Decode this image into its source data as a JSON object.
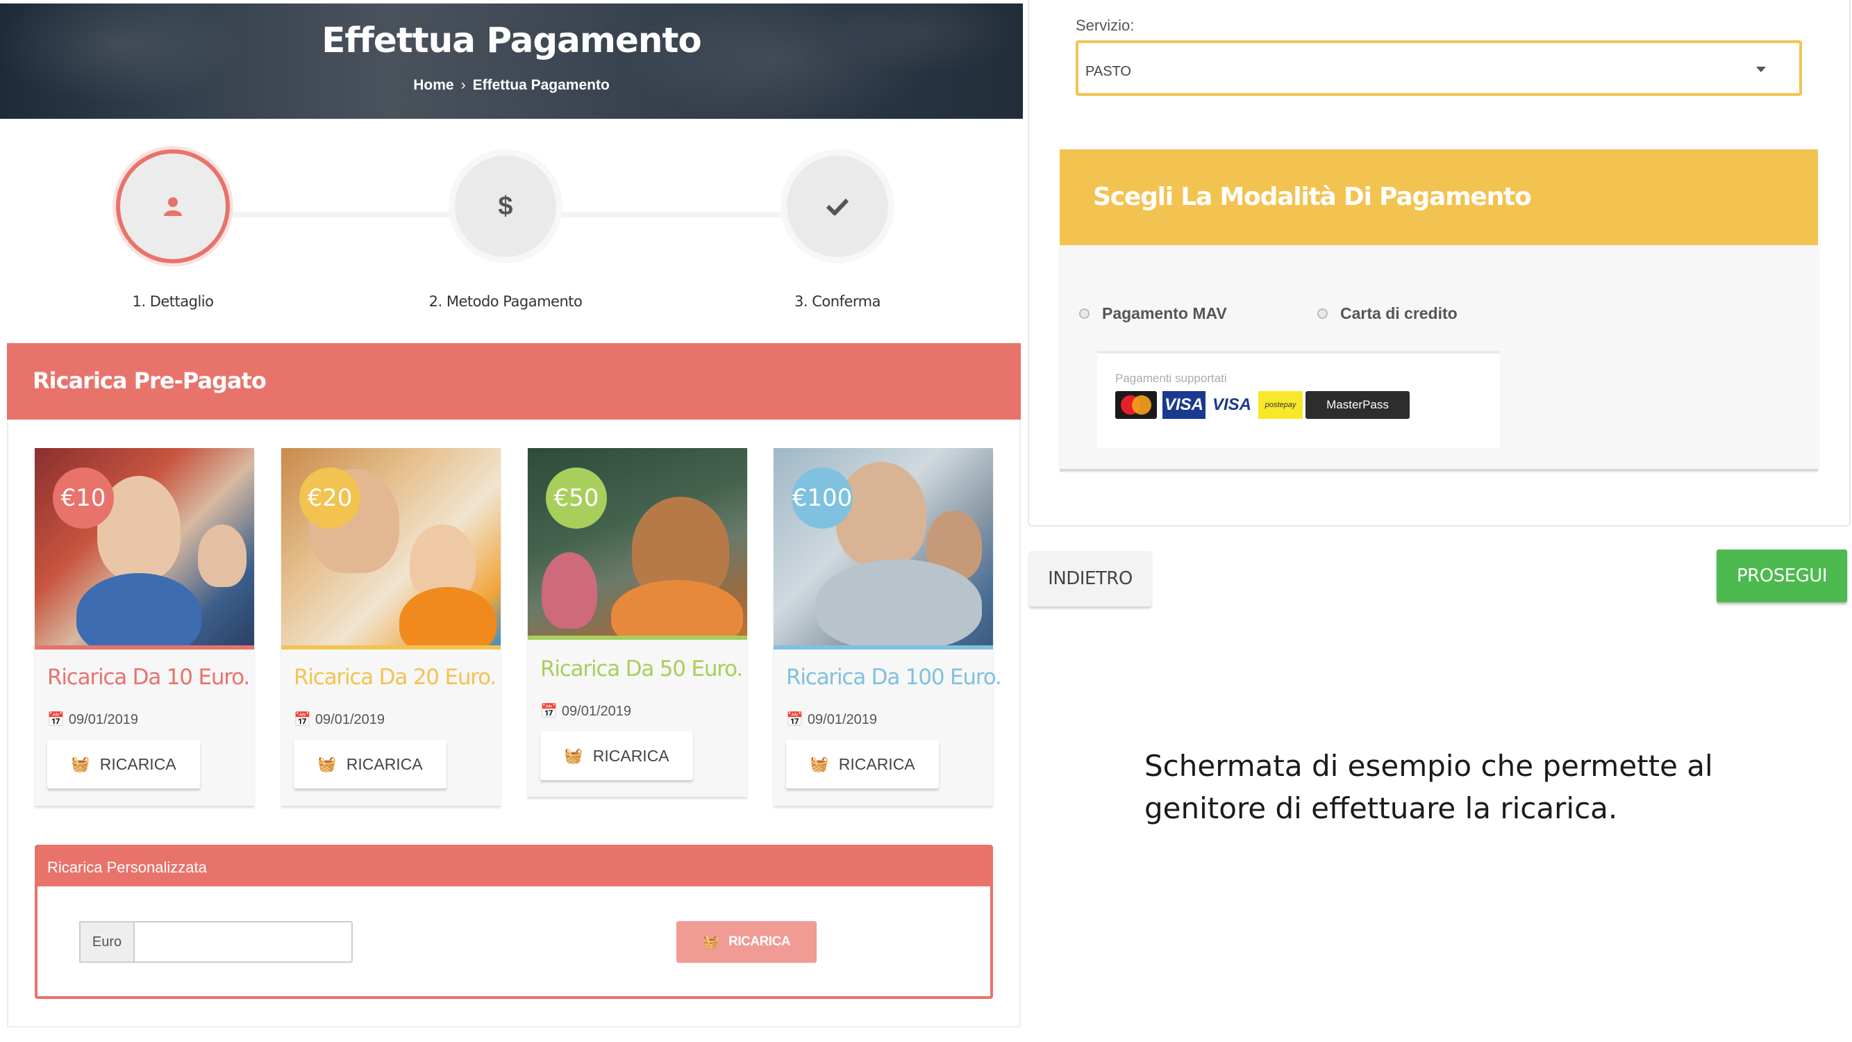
{
  "hero": {
    "title": "Effettua Pagamento",
    "breadcrumb_home": "Home",
    "breadcrumb_current": "Effettua Pagamento"
  },
  "steps": [
    {
      "label": "1. Dettaglio",
      "icon": "user-icon",
      "active": true
    },
    {
      "label": "2. Metodo Pagamento",
      "icon": "dollar-icon",
      "active": false
    },
    {
      "label": "3. Conferma",
      "icon": "check-icon",
      "active": false
    }
  ],
  "prepaid": {
    "title": "Ricarica Pre-Pagato",
    "cards": [
      {
        "price": "€10",
        "title": "Ricarica Da 10 Euro.",
        "date": "09/01/2019",
        "button": "RICARICA",
        "color": "#e8736b"
      },
      {
        "price": "€20",
        "title": "Ricarica Da 20 Euro.",
        "date": "09/01/2019",
        "button": "RICARICA",
        "color": "#f2c350"
      },
      {
        "price": "€50",
        "title": "Ricarica Da 50 Euro.",
        "date": "09/01/2019",
        "button": "RICARICA",
        "color": "#a8cf5c"
      },
      {
        "price": "€100",
        "title": "Ricarica Da 100 Euro.",
        "date": "09/01/2019",
        "button": "RICARICA",
        "color": "#7fc1de"
      }
    ]
  },
  "custom": {
    "title": "Ricarica Personalizzata",
    "addon": "Euro",
    "value": "",
    "button": "RICARICA"
  },
  "service": {
    "label": "Servizio:",
    "selected": "PASTO"
  },
  "payment": {
    "title": "Scegli La Modalità Di Pagamento",
    "options": [
      "Pagamento MAV",
      "Carta di credito"
    ],
    "supported_label": "Pagamenti supportati",
    "logos": {
      "visa": "VISA",
      "visa_electron": "VISA",
      "postepay": "postepay",
      "masterpass": "MasterPass"
    }
  },
  "actions": {
    "back": "INDIETRO",
    "next": "PROSEGUI"
  },
  "caption": "Schermata di esempio che permette al genitore di effettuare la ricarica.",
  "colors": {
    "accent_red": "#e8736b",
    "accent_yellow": "#f2c350",
    "accent_green": "#4cba4e"
  }
}
